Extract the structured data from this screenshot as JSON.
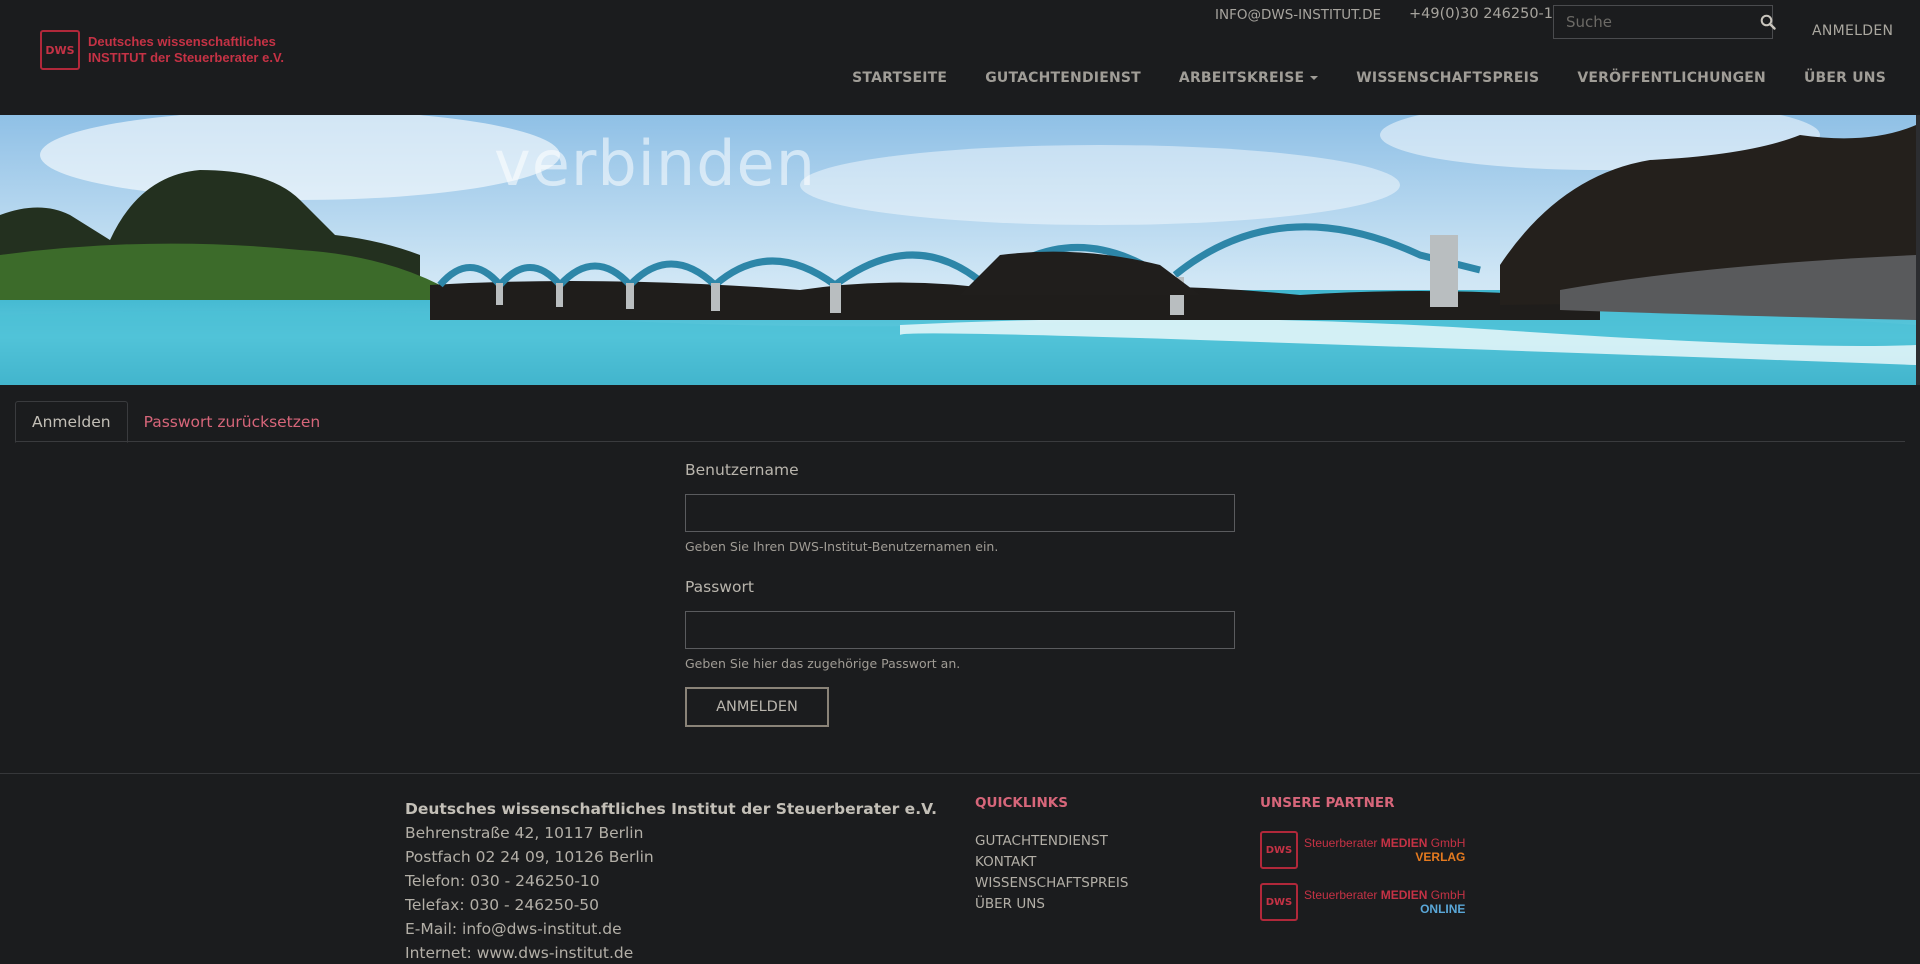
{
  "logo": {
    "mark": "DWS",
    "line1": "Deutsches wissenschaftliches",
    "line2": "INSTITUT der Steuerberater e.V."
  },
  "topbar": {
    "email": "INFO@DWS-INSTITUT.DE",
    "phone": "+49(0)30 246250-10",
    "search_placeholder": "Suche",
    "login": "ANMELDEN"
  },
  "nav": {
    "items": [
      {
        "label": "STARTSEITE"
      },
      {
        "label": "GUTACHTENDIENST"
      },
      {
        "label": "ARBEITSKREISE"
      },
      {
        "label": "WISSENSCHAFTSPREIS"
      },
      {
        "label": "VERÖFFENTLICHUNGEN"
      },
      {
        "label": "ÜBER UNS"
      }
    ]
  },
  "hero": {
    "title": "verbinden"
  },
  "tabs": {
    "login": "Anmelden",
    "reset": "Passwort zurücksetzen"
  },
  "form": {
    "username_label": "Benutzername",
    "username_value": "",
    "username_help": "Geben Sie Ihren DWS-Institut-Benutzernamen ein.",
    "password_label": "Passwort",
    "password_value": "",
    "password_help": "Geben Sie hier das zugehörige Passwort an.",
    "submit": "ANMELDEN"
  },
  "footer": {
    "org_name": "Deutsches wissenschaftliches Institut der Steuerberater e.V.",
    "address": "Behrenstraße 42, 10117 Berlin",
    "postfach": "Postfach 02 24 09, 10126 Berlin",
    "telefon": "Telefon: 030 - 246250-10",
    "telefax": "Telefax: 030 - 246250-50",
    "email": "E-Mail: info@dws-institut.de",
    "internet": "Internet: www.dws-institut.de",
    "quicklinks_title": "QUICKLINKS",
    "quicklinks": [
      {
        "label": "GUTACHTENDIENST"
      },
      {
        "label": "KONTAKT"
      },
      {
        "label": "WISSENSCHAFTSPREIS"
      },
      {
        "label": "ÜBER UNS"
      }
    ],
    "partners_title": "UNSERE PARTNER",
    "partners": [
      {
        "mark": "DWS",
        "name_prefix": "Steuerberater ",
        "name_bold": "MEDIEN",
        "name_suffix": " GmbH",
        "sub": "VERLAG"
      },
      {
        "mark": "DWS",
        "name_prefix": "Steuerberater ",
        "name_bold": "MEDIEN",
        "name_suffix": " GmbH",
        "sub": "ONLINE"
      }
    ]
  },
  "colors": {
    "background": "#1b1c1e",
    "accent": "#d7667a",
    "brand_red": "#c53245"
  }
}
